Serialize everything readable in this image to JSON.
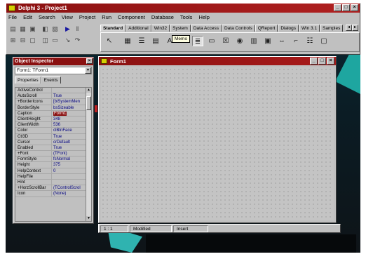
{
  "main_window": {
    "title": "Delphi 3 - Project1",
    "menu": [
      "File",
      "Edit",
      "Search",
      "View",
      "Project",
      "Run",
      "Component",
      "Database",
      "Tools",
      "Help"
    ]
  },
  "palette": {
    "tabs": [
      "Standard",
      "Additional",
      "Win32",
      "System",
      "Data Access",
      "Data Controls",
      "QReport",
      "Dialogs",
      "Win 3.1",
      "Samples"
    ],
    "active_tab": "Standard",
    "tooltip": "Memo",
    "components": [
      {
        "name": "pointer",
        "glyph": "↖"
      },
      {
        "name": "frames",
        "glyph": "▦"
      },
      {
        "name": "mainmenu",
        "glyph": "☰"
      },
      {
        "name": "popupmenu",
        "glyph": "▤"
      },
      {
        "name": "label",
        "glyph": "A"
      },
      {
        "name": "edit",
        "glyph": "ab"
      },
      {
        "name": "memo",
        "glyph": "≣"
      },
      {
        "name": "button",
        "glyph": "▭"
      },
      {
        "name": "checkbox",
        "glyph": "☒"
      },
      {
        "name": "radiobutton",
        "glyph": "◉"
      },
      {
        "name": "listbox",
        "glyph": "▥"
      },
      {
        "name": "combobox",
        "glyph": "▣"
      },
      {
        "name": "scrollbar",
        "glyph": "⇔"
      },
      {
        "name": "groupbox",
        "glyph": "⌐"
      },
      {
        "name": "radiogroup",
        "glyph": "☷"
      },
      {
        "name": "panel",
        "glyph": "▢"
      }
    ]
  },
  "object_inspector": {
    "title": "Object Inspector",
    "selected_object": "Form1: TForm1",
    "tabs": [
      "Properties",
      "Events"
    ],
    "active_tab": "Properties",
    "selected_property": "Caption",
    "properties": [
      {
        "name": "ActiveControl",
        "value": ""
      },
      {
        "name": "AutoScroll",
        "value": "True"
      },
      {
        "name": "+BorderIcons",
        "value": "[biSystemMen"
      },
      {
        "name": "BorderStyle",
        "value": "bsSizeable"
      },
      {
        "name": "Caption",
        "value": "Form1"
      },
      {
        "name": "ClientHeight",
        "value": "348"
      },
      {
        "name": "ClientWidth",
        "value": "536"
      },
      {
        "name": "Color",
        "value": "clBtnFace"
      },
      {
        "name": "Ctl3D",
        "value": "True"
      },
      {
        "name": "Cursor",
        "value": "crDefault"
      },
      {
        "name": "Enabled",
        "value": "True"
      },
      {
        "name": "+Font",
        "value": "(TFont)"
      },
      {
        "name": "FormStyle",
        "value": "fsNormal"
      },
      {
        "name": "Height",
        "value": "375"
      },
      {
        "name": "HelpContext",
        "value": "0"
      },
      {
        "name": "HelpFile",
        "value": ""
      },
      {
        "name": "Hint",
        "value": ""
      },
      {
        "name": "+HorzScrollBar",
        "value": "(TControlScrol"
      },
      {
        "name": "Icon",
        "value": "(None)"
      }
    ]
  },
  "form1": {
    "title": "Form1"
  },
  "editor_status": {
    "position": "1 : 1",
    "state": "Modified",
    "mode": "Insert"
  },
  "colors": {
    "titlebar": "#8a1010",
    "face": "#c0c0c0",
    "value_text": "#000080"
  }
}
